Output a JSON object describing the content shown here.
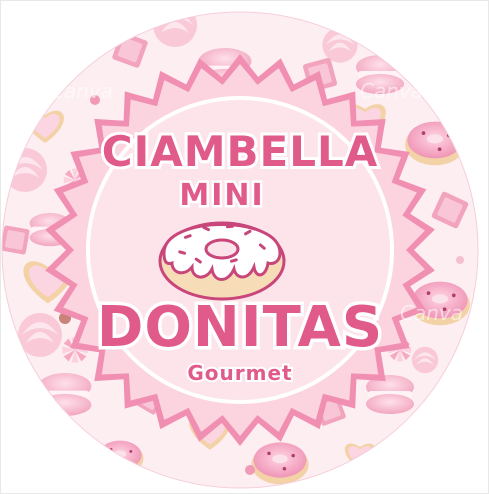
{
  "label": {
    "line_1": "CIAMBELLA",
    "line_2": "MINI",
    "line_3": "DONITAS",
    "line_4": "Gourmet"
  },
  "watermark": "Canva",
  "colors": {
    "page_bg": "#ffffff",
    "pattern_bg": "#fdeef2",
    "badge_border": "#f08fb1",
    "badge_fill": "#fbd4df",
    "inner_circle": "#fde3ea",
    "title_pink": "#e05a8a",
    "title_stroke": "#ffffff",
    "donut_dough": "#f6dcb7",
    "donut_icing": "#ffffff",
    "donut_outline": "#c8467a"
  },
  "decorations": [
    "donut-icon",
    "macaron-icon",
    "heart-cookie-icon",
    "meringue-icon",
    "chocolate-square-icon",
    "candy-ball-icon",
    "lollipop-icon"
  ]
}
